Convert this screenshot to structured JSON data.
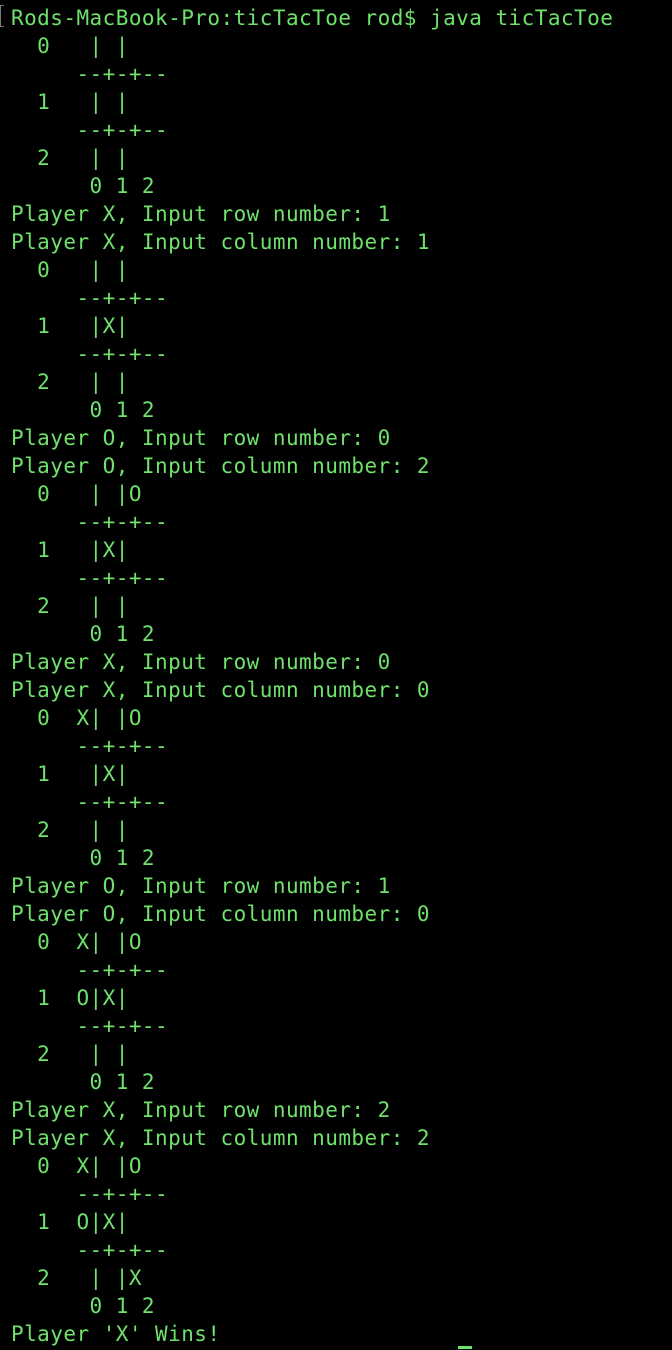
{
  "theme": {
    "background": "#000000",
    "foreground": "#6ee26b",
    "bracket": "#7a7a7a"
  },
  "terminal": {
    "lines": [
      "Rods-MacBook-Pro:ticTacToe rod$ java ticTacToe",
      "  0   | |",
      "     --+-+--",
      "  1   | |",
      "     --+-+--",
      "  2   | |",
      "      0 1 2",
      "Player X, Input row number: 1",
      "Player X, Input column number: 1",
      "  0   | |",
      "     --+-+--",
      "  1   |X|",
      "     --+-+--",
      "  2   | |",
      "      0 1 2",
      "Player O, Input row number: 0",
      "Player O, Input column number: 2",
      "  0   | |O",
      "     --+-+--",
      "  1   |X|",
      "     --+-+--",
      "  2   | |",
      "      0 1 2",
      "Player X, Input row number: 0",
      "Player X, Input column number: 0",
      "  0  X| |O",
      "     --+-+--",
      "  1   |X|",
      "     --+-+--",
      "  2   | |",
      "      0 1 2",
      "Player O, Input row number: 1",
      "Player O, Input column number: 0",
      "  0  X| |O",
      "     --+-+--",
      "  1  O|X|",
      "     --+-+--",
      "  2   | |",
      "      0 1 2",
      "Player X, Input row number: 2",
      "Player X, Input column number: 2",
      "  0  X| |O",
      "     --+-+--",
      "  1  O|X|",
      "     --+-+--",
      "  2   | |X",
      "      0 1 2",
      "Player 'X' Wins!"
    ]
  }
}
